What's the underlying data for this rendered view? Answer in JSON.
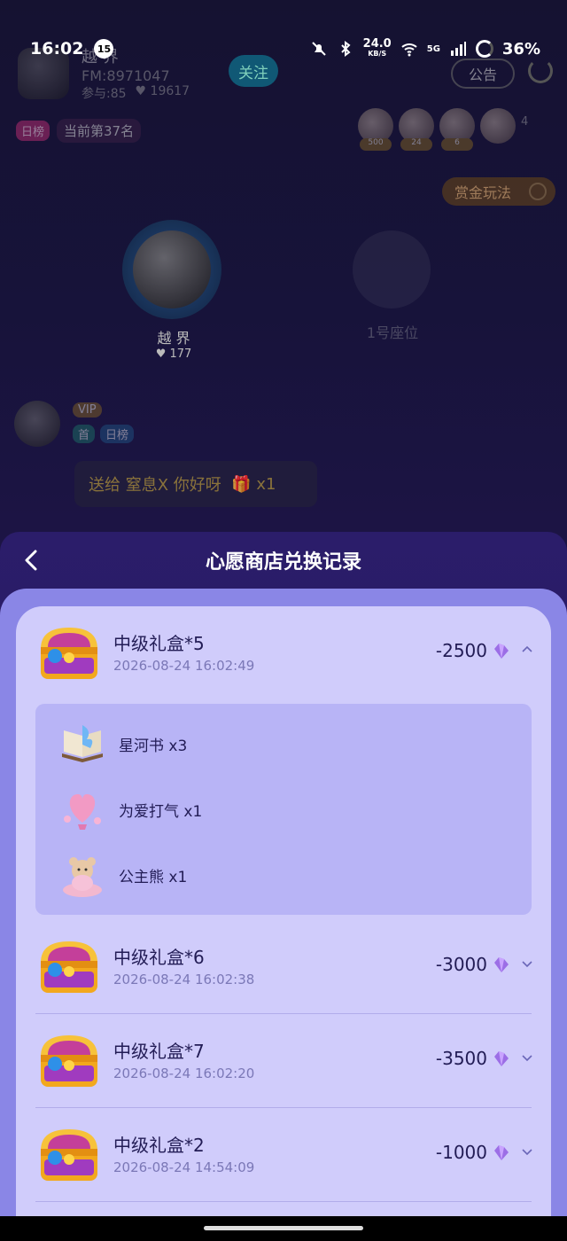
{
  "status_bar": {
    "time": "16:02",
    "notification_count": "15",
    "net_speed": "24.0",
    "net_speed_unit": "KB/S",
    "signal": "5G",
    "battery": "36%"
  },
  "room": {
    "host_name": "越 界",
    "fm_id": "FM:8971047",
    "participants": "参与:85",
    "likes": "19617",
    "follow_label": "关注",
    "notice_label": "公告",
    "rank_tag": "日榜",
    "rank_text": "当前第37名",
    "audience_badges": [
      "500",
      "24",
      "6"
    ],
    "audience_count": "4",
    "reward_label": "赏金玩法",
    "seat_host_name": "越 界",
    "seat_host_hearts": "177",
    "seat1_label": "1号座位",
    "chat_tag_vip": "VIP",
    "chat_tag_first": "首",
    "chat_tag_daily": "日榜",
    "chat_message": "送给 窒息X 你好呀",
    "chat_qty": "x1"
  },
  "sheet": {
    "title": "心愿商店兑换记录",
    "records": [
      {
        "title": "中级礼盒*5",
        "time": "2026-08-24 16:02:49",
        "amount": "-2500",
        "expanded": true,
        "items": [
          {
            "label": "星河书 x3",
            "icon": "star-river-book-icon"
          },
          {
            "label": "为爱打气 x1",
            "icon": "love-balloon-icon"
          },
          {
            "label": "公主熊 x1",
            "icon": "princess-bear-icon"
          }
        ]
      },
      {
        "title": "中级礼盒*6",
        "time": "2026-08-24 16:02:38",
        "amount": "-3000",
        "expanded": false
      },
      {
        "title": "中级礼盒*7",
        "time": "2026-08-24 16:02:20",
        "amount": "-3500",
        "expanded": false
      },
      {
        "title": "中级礼盒*2",
        "time": "2026-08-24 14:54:09",
        "amount": "-1000",
        "expanded": false
      }
    ]
  },
  "colors": {
    "sheet_bg": "#2b1d6a",
    "panel_bg": "#8a86e6",
    "list_bg": "#d0ccfb",
    "sublist_bg": "#b8b4f6",
    "text_dark": "#221c55",
    "text_muted": "#7b78b7"
  }
}
